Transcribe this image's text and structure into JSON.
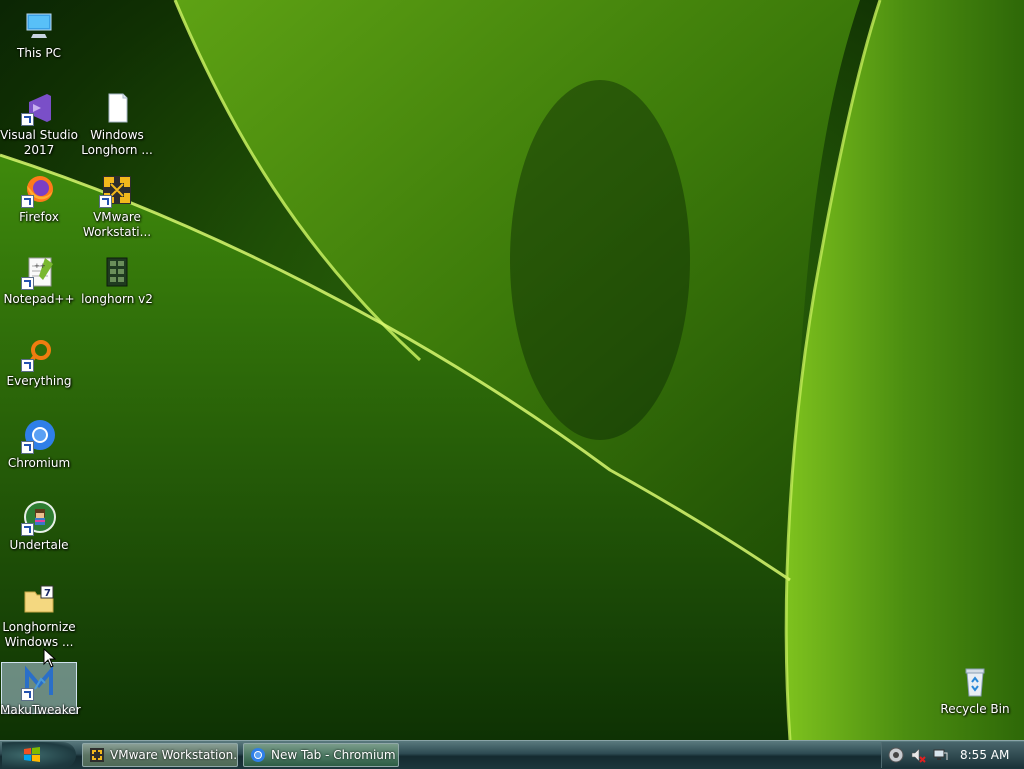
{
  "desktop": {
    "icons": [
      {
        "label": "This PC"
      },
      {
        "label": "Visual Studio\n2017"
      },
      {
        "label": "Windows\nLonghorn ..."
      },
      {
        "label": "Firefox"
      },
      {
        "label": "VMware\nWorkstati..."
      },
      {
        "label": "Notepad++"
      },
      {
        "label": "longhorn v2"
      },
      {
        "label": "Everything"
      },
      {
        "label": "Chromium"
      },
      {
        "label": "Undertale"
      },
      {
        "label": "Longhornize\nWindows ..."
      },
      {
        "label": "MakuTweaker"
      },
      {
        "label": "Recycle Bin"
      }
    ],
    "selected_icon": "MakuTweaker"
  },
  "taskbar": {
    "tasks": [
      {
        "label": "VMware Workstation..."
      },
      {
        "label": "New Tab - Chromium"
      }
    ],
    "clock": "8:55 AM"
  },
  "colors": {
    "wallpaper_dark": "#103003",
    "wallpaper_light": "#a6e030",
    "taskbar": "#1c363c"
  }
}
